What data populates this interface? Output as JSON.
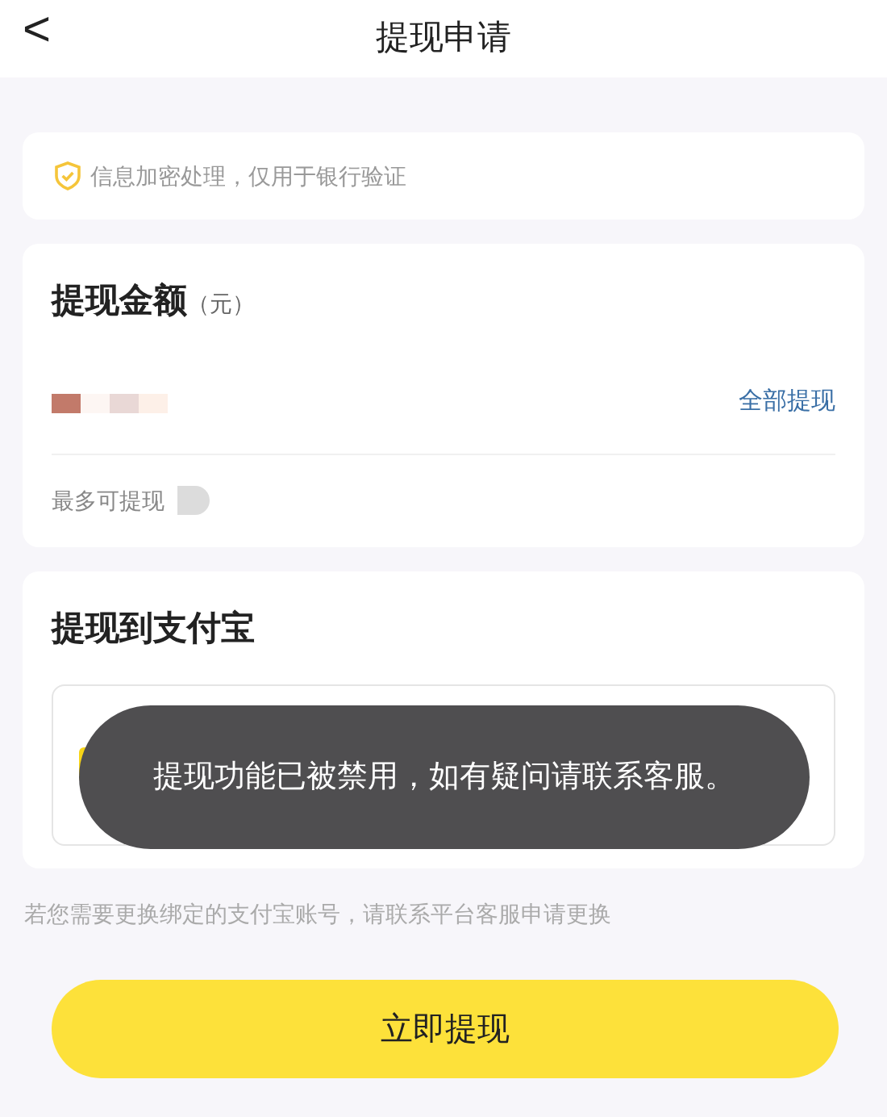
{
  "header": {
    "back": "<",
    "title": "提现申请"
  },
  "notice": "信息加密处理，仅用于银行验证",
  "amount": {
    "title": "提现金额",
    "unit": "（元）",
    "withdraw_all": "全部提现",
    "max_label": "最多可提现"
  },
  "alipay": {
    "title": "提现到支付宝"
  },
  "hint": "若您需要更换绑定的支付宝账号，请联系平台客服申请更换",
  "submit": "立即提现",
  "toast": "提现功能已被禁用，如有疑问请联系客服。"
}
